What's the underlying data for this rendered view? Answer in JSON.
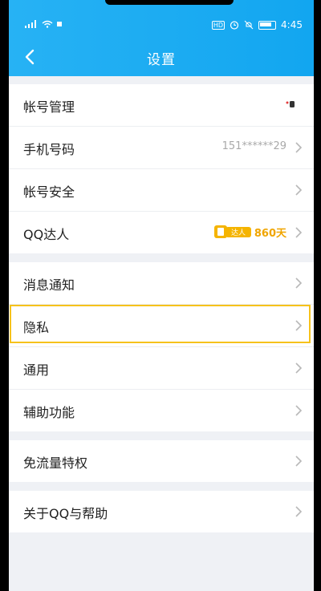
{
  "status_bar": {
    "hd_badge": "HD",
    "time": "4:45"
  },
  "header": {
    "title": "设置"
  },
  "groups": [
    {
      "items": [
        {
          "label": "帐号管理"
        },
        {
          "label": "手机号码",
          "value": "151******29"
        },
        {
          "label": "帐号安全"
        },
        {
          "label": "QQ达人",
          "badge_text": "达人",
          "days": "860天"
        }
      ]
    },
    {
      "items": [
        {
          "label": "消息通知"
        },
        {
          "label": "隐私"
        },
        {
          "label": "通用"
        },
        {
          "label": "辅助功能"
        }
      ]
    },
    {
      "items": [
        {
          "label": "免流量特权"
        }
      ]
    },
    {
      "items": [
        {
          "label": "关于QQ与帮助"
        }
      ]
    }
  ],
  "colors": {
    "header_blue": "#1aaaf2",
    "highlight": "#f6c21b",
    "badge_orange": "#f0a500",
    "background": "#eff1f5"
  }
}
